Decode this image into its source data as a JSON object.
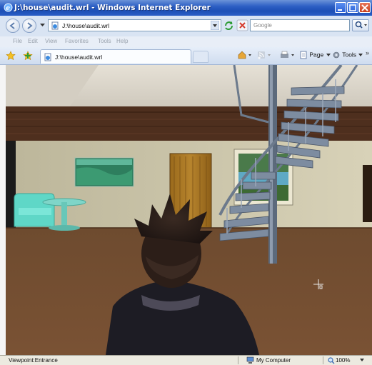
{
  "window": {
    "title": "J:\\house\\audit.wrl - Windows Internet Explorer"
  },
  "address_bar": {
    "url": "J:\\house\\audit.wrl",
    "search_placeholder": "Google"
  },
  "menu": [
    "File",
    "Edit",
    "View",
    "Favorites",
    "Tools",
    "Help"
  ],
  "tab": {
    "label": "J:\\house\\audit.wrl"
  },
  "command_bar": {
    "page_label": "Page",
    "tools_label": "Tools",
    "more_label": "»"
  },
  "status_bar": {
    "text": "Viewpoint:Entrance",
    "zone": "My Computer",
    "zoom": "100%"
  },
  "colors": {
    "titlebar": "#2d5fc4",
    "floor": "#6b4a30",
    "wall": "#c9c2a3",
    "ceiling": "#d9d4c8"
  }
}
